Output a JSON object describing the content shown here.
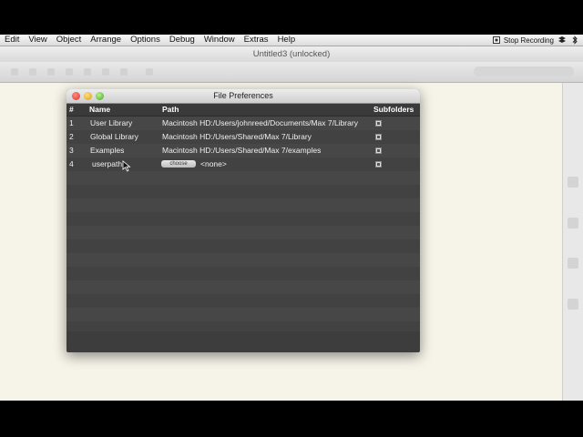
{
  "menubar": {
    "items": [
      "Edit",
      "View",
      "Object",
      "Arrange",
      "Options",
      "Debug",
      "Window",
      "Extras",
      "Help"
    ],
    "stop_recording": "Stop Recording"
  },
  "window": {
    "title": "Untitled3 (unlocked)"
  },
  "dialog": {
    "title": "File Preferences",
    "columns": {
      "num": "#",
      "name": "Name",
      "path": "Path",
      "subfolders": "Subfolders"
    },
    "rows": [
      {
        "num": "1",
        "name": "User Library",
        "path": "Macintosh HD:/Users/johnreed/Documents/Max 7/Library",
        "subfolders": true
      },
      {
        "num": "2",
        "name": "Global Library",
        "path": "Macintosh HD:/Users/Shared/Max 7/Library",
        "subfolders": true
      },
      {
        "num": "3",
        "name": "Examples",
        "path": "Macintosh HD:/Users/Shared/Max 7/examples",
        "subfolders": true
      },
      {
        "num": "4",
        "name": "userpath",
        "choose_label": "choose",
        "path": "<none>",
        "subfolders": true
      }
    ],
    "footer": {
      "add": "+",
      "remove": "−",
      "options": "☰",
      "back": "⇐"
    }
  }
}
